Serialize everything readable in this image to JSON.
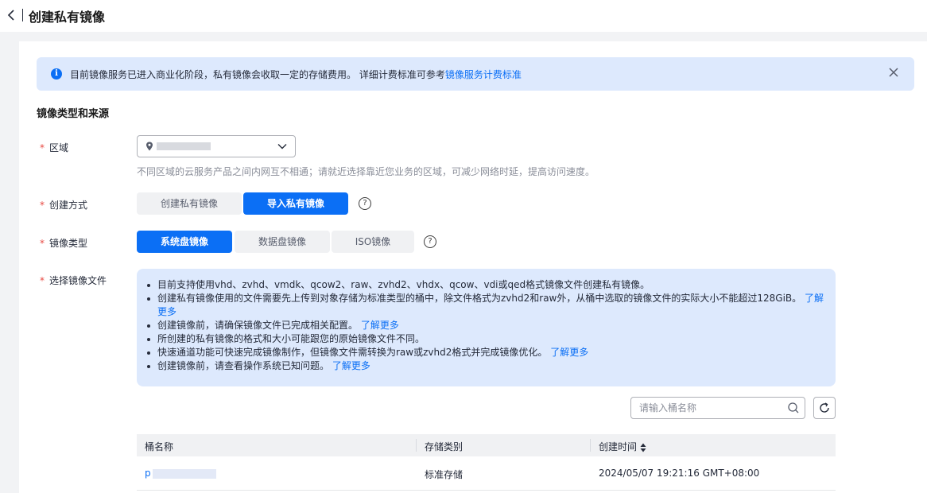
{
  "header": {
    "title": "创建私有镜像"
  },
  "notice": {
    "text": "目前镜像服务已进入商业化阶段，私有镜像会收取一定的存储费用。 详细计费标准可参考",
    "link": "镜像服务计费标准"
  },
  "section": {
    "title": "镜像类型和来源"
  },
  "region": {
    "label": "区域",
    "hint": "不同区域的云服务产品之间内网互不相通；请就近选择靠近您业务的区域，可减少网络时延，提高访问速度。"
  },
  "create_method": {
    "label": "创建方式",
    "options": [
      "创建私有镜像",
      "导入私有镜像"
    ],
    "selected": "导入私有镜像"
  },
  "image_type": {
    "label": "镜像类型",
    "options": [
      "系统盘镜像",
      "数据盘镜像",
      "ISO镜像"
    ],
    "selected": "系统盘镜像"
  },
  "image_file": {
    "label": "选择镜像文件",
    "tips": [
      {
        "text": "目前支持使用vhd、zvhd、vmdk、qcow2、raw、zvhd2、vhdx、qcow、vdi或qed格式镜像文件创建私有镜像。",
        "link": ""
      },
      {
        "text": "创建私有镜像使用的文件需要先上传到对象存储为标准类型的桶中，除文件格式为zvhd2和raw外，从桶中选取的镜像文件的实际大小不能超过128GiB。",
        "link": "了解更多"
      },
      {
        "text": "创建镜像前，请确保镜像文件已完成相关配置。",
        "link": "了解更多"
      },
      {
        "text": "所创建的私有镜像的格式和大小可能跟您的原始镜像文件不同。",
        "link": ""
      },
      {
        "text": "快速通道功能可快速完成镜像制作，但镜像文件需转换为raw或zvhd2格式并完成镜像优化。",
        "link": "了解更多"
      },
      {
        "text": "创建镜像前，请查看操作系统已知问题。",
        "link": "了解更多"
      }
    ]
  },
  "search": {
    "placeholder": "请输入桶名称",
    "value": ""
  },
  "table": {
    "columns": [
      "桶名称",
      "存储类别",
      "创建时间"
    ],
    "rows": [
      {
        "name": "p",
        "storage": "标准存储",
        "created": "2024/05/07 19:21:16 GMT+08:00"
      }
    ]
  },
  "colors": {
    "primary": "#0b6ff5",
    "notice_bg": "#dde9fd",
    "required": "#e84a43"
  }
}
